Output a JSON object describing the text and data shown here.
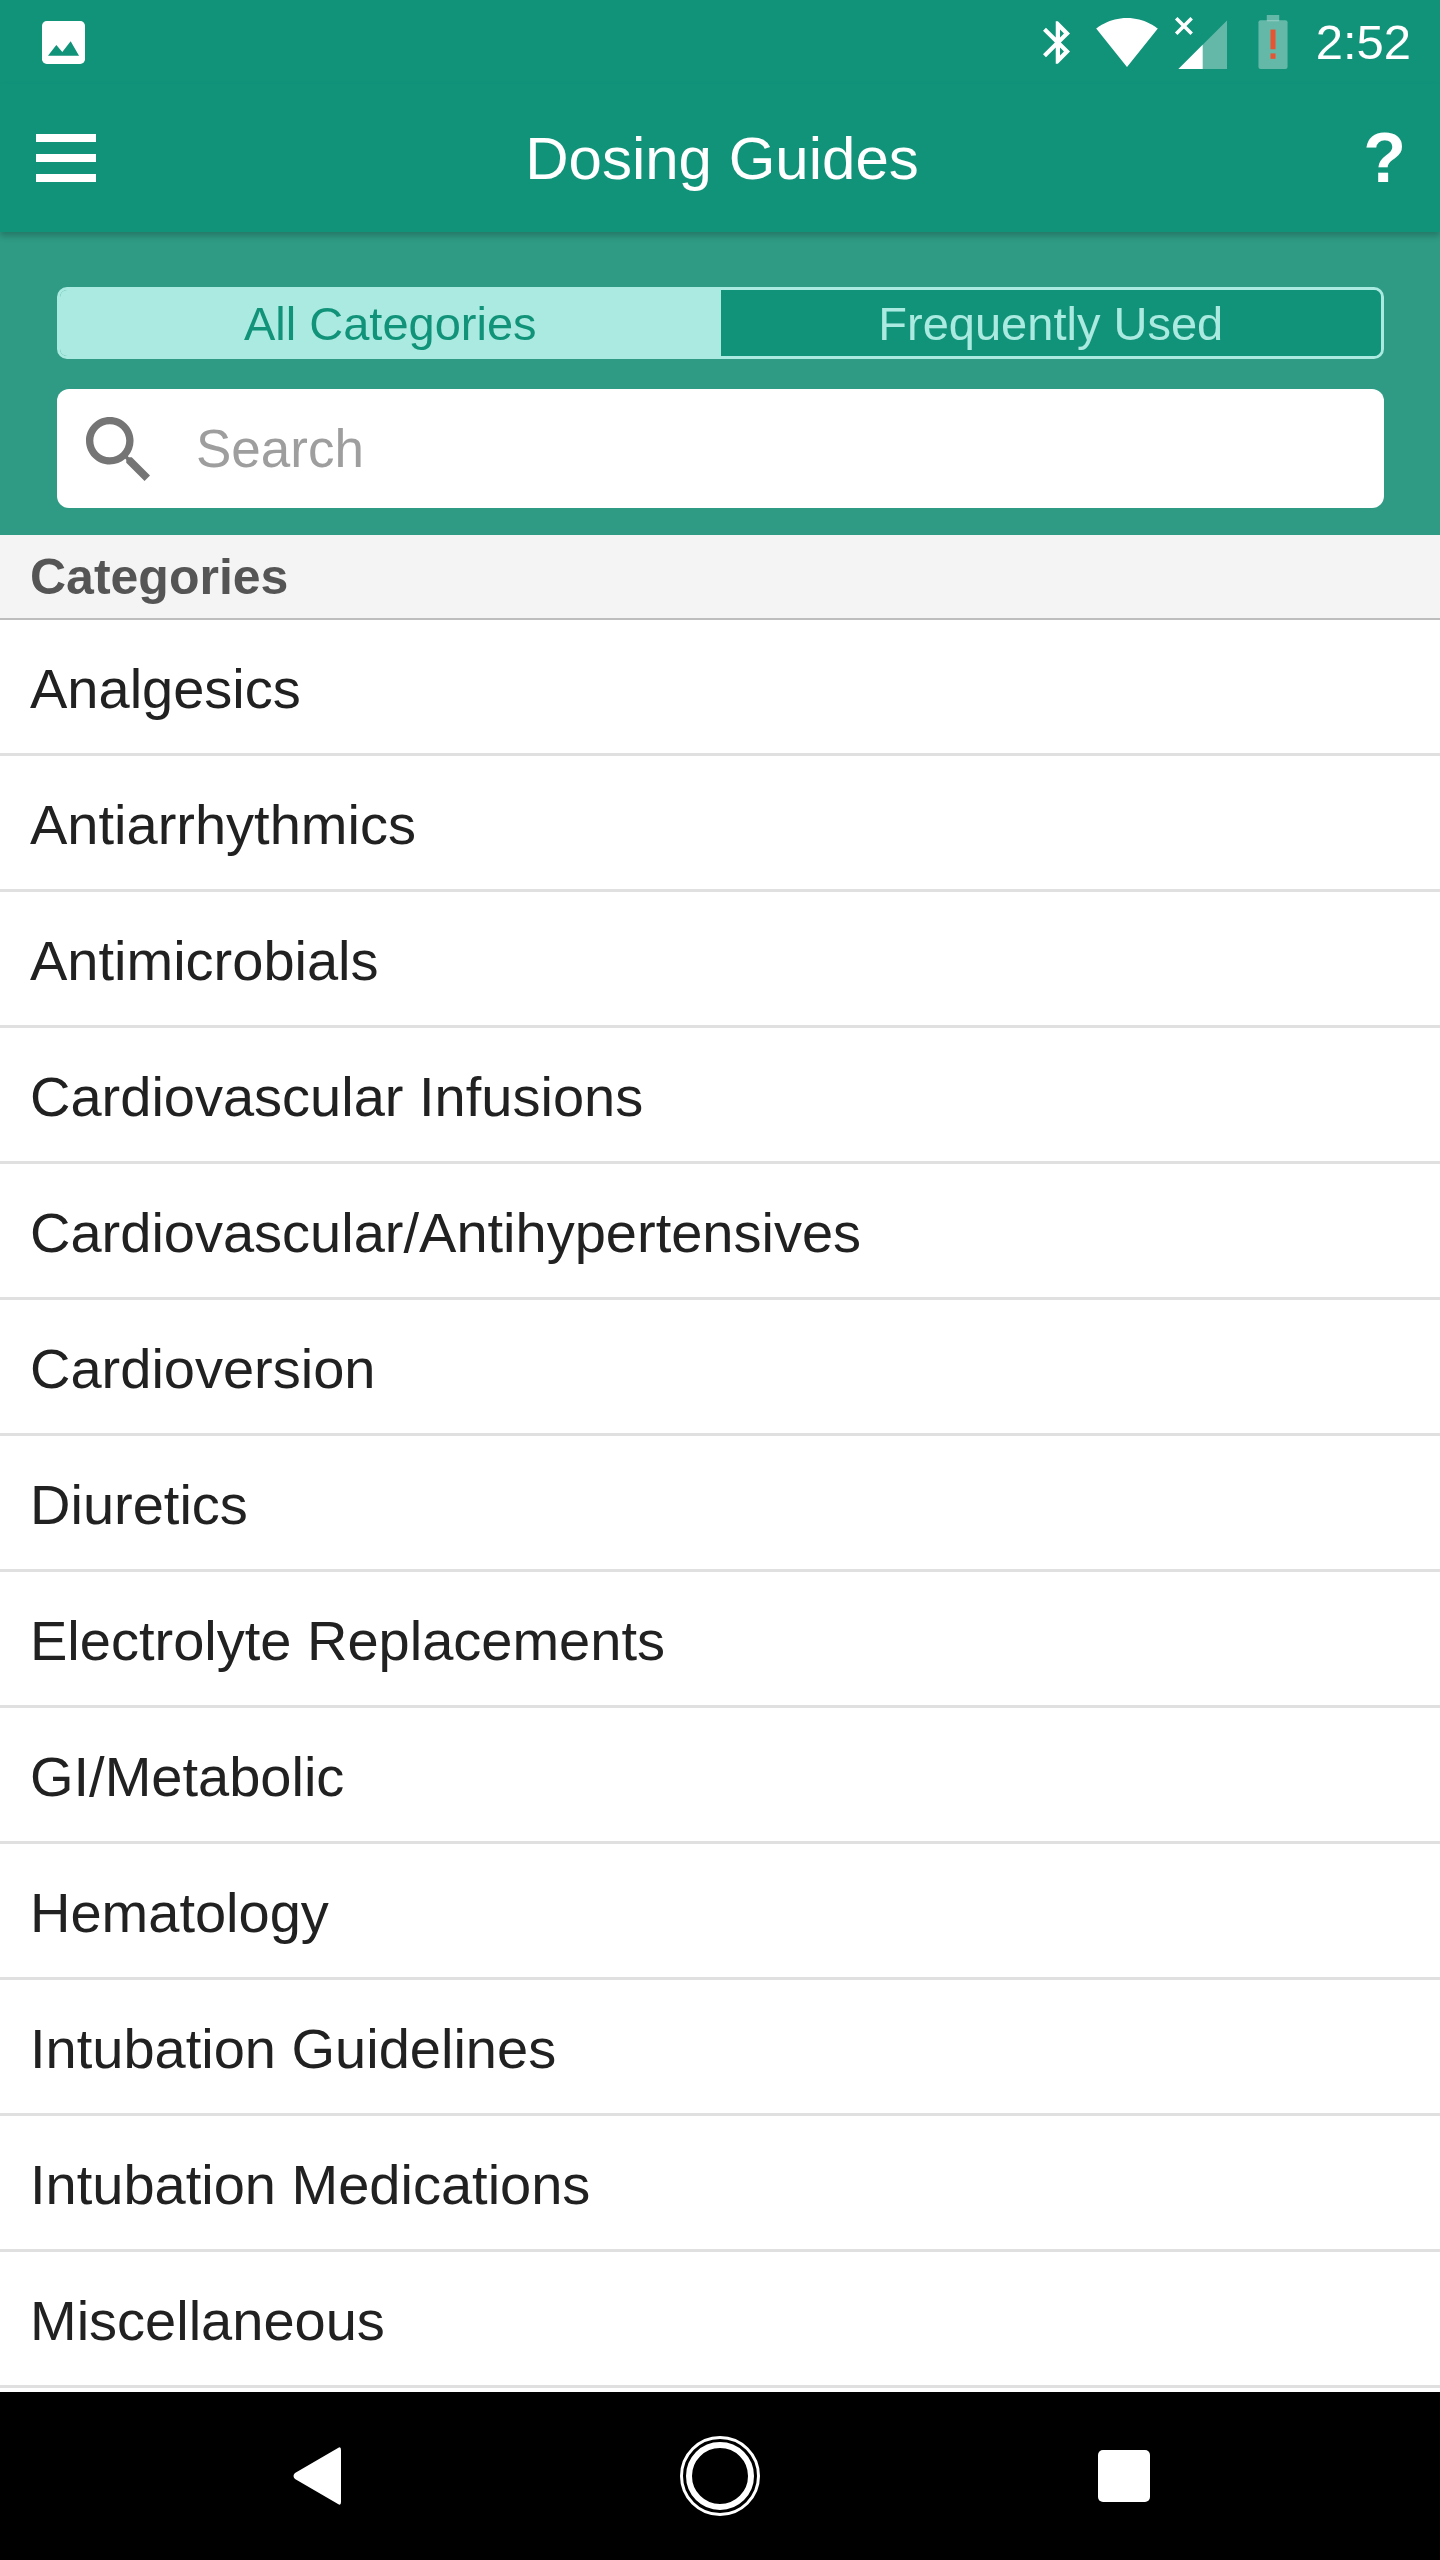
{
  "status_bar": {
    "time": "2:52"
  },
  "app_bar": {
    "title": "Dosing Guides",
    "help_button": "?"
  },
  "tabs": [
    {
      "label": "All Categories",
      "selected": true
    },
    {
      "label": "Frequently Used",
      "selected": false
    }
  ],
  "search": {
    "placeholder": "Search"
  },
  "list": {
    "header": "Categories",
    "items": [
      "Analgesics",
      "Antiarrhythmics",
      "Antimicrobials",
      "Cardiovascular Infusions",
      "Cardiovascular/Antihypertensives",
      "Cardioversion",
      "Diuretics",
      "Electrolyte Replacements",
      "GI/Metabolic",
      "Hematology",
      "Intubation Guidelines",
      "Intubation Medications",
      "Miscellaneous"
    ]
  }
}
